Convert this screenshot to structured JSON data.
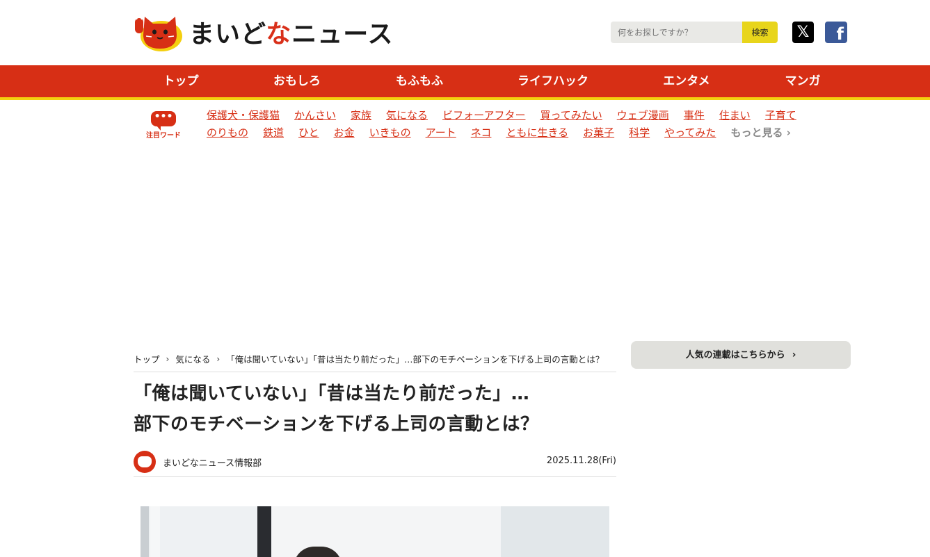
{
  "header": {
    "logo_text_main": "まいど",
    "logo_text_accent": "な",
    "logo_text_tail": "ニュース",
    "search_placeholder": "何をお探しですか？",
    "search_button": "検索",
    "x_icon": "x-logo-icon",
    "facebook_icon": "facebook-icon"
  },
  "nav": {
    "items": [
      "トップ",
      "おもしろ",
      "もふもふ",
      "ライフハック",
      "エンタメ",
      "マンガ"
    ]
  },
  "keywords": {
    "badge_label": "注目ワード",
    "row1": [
      "保護犬・保護猫",
      "かんさい",
      "家族",
      "気になる",
      "ビフォーアフター",
      "買ってみたい",
      "ウェブ漫画",
      "事件",
      "住まい",
      "子育て"
    ],
    "row2": [
      "のりもの",
      "鉄道",
      "ひと",
      "お金",
      "いきもの",
      "アート",
      "ネコ",
      "ともに生きる",
      "お菓子",
      "科学",
      "やってみた"
    ],
    "more": "もっと見る"
  },
  "breadcrumb": {
    "items": [
      "トップ",
      "気になる",
      "「俺は聞いていない」「昔は当たり前だった」…部下のモチベーションを下げる上司の言動とは？"
    ]
  },
  "article": {
    "title_line1": "「俺は聞いていない」「昔は当たり前だった」…",
    "title_line2": "部下のモチベーションを下げる上司の言動とは？",
    "author": "まいどなニュース情報部",
    "date": "2025.11.28(Fri)"
  },
  "sidebar": {
    "series_button": "人気の連載はこちらから"
  },
  "colors": {
    "brand_red": "#d72f15",
    "accent_yellow": "#f4cf0f",
    "search_button_bg": "#e8d51b",
    "facebook_blue": "#3b5998"
  }
}
